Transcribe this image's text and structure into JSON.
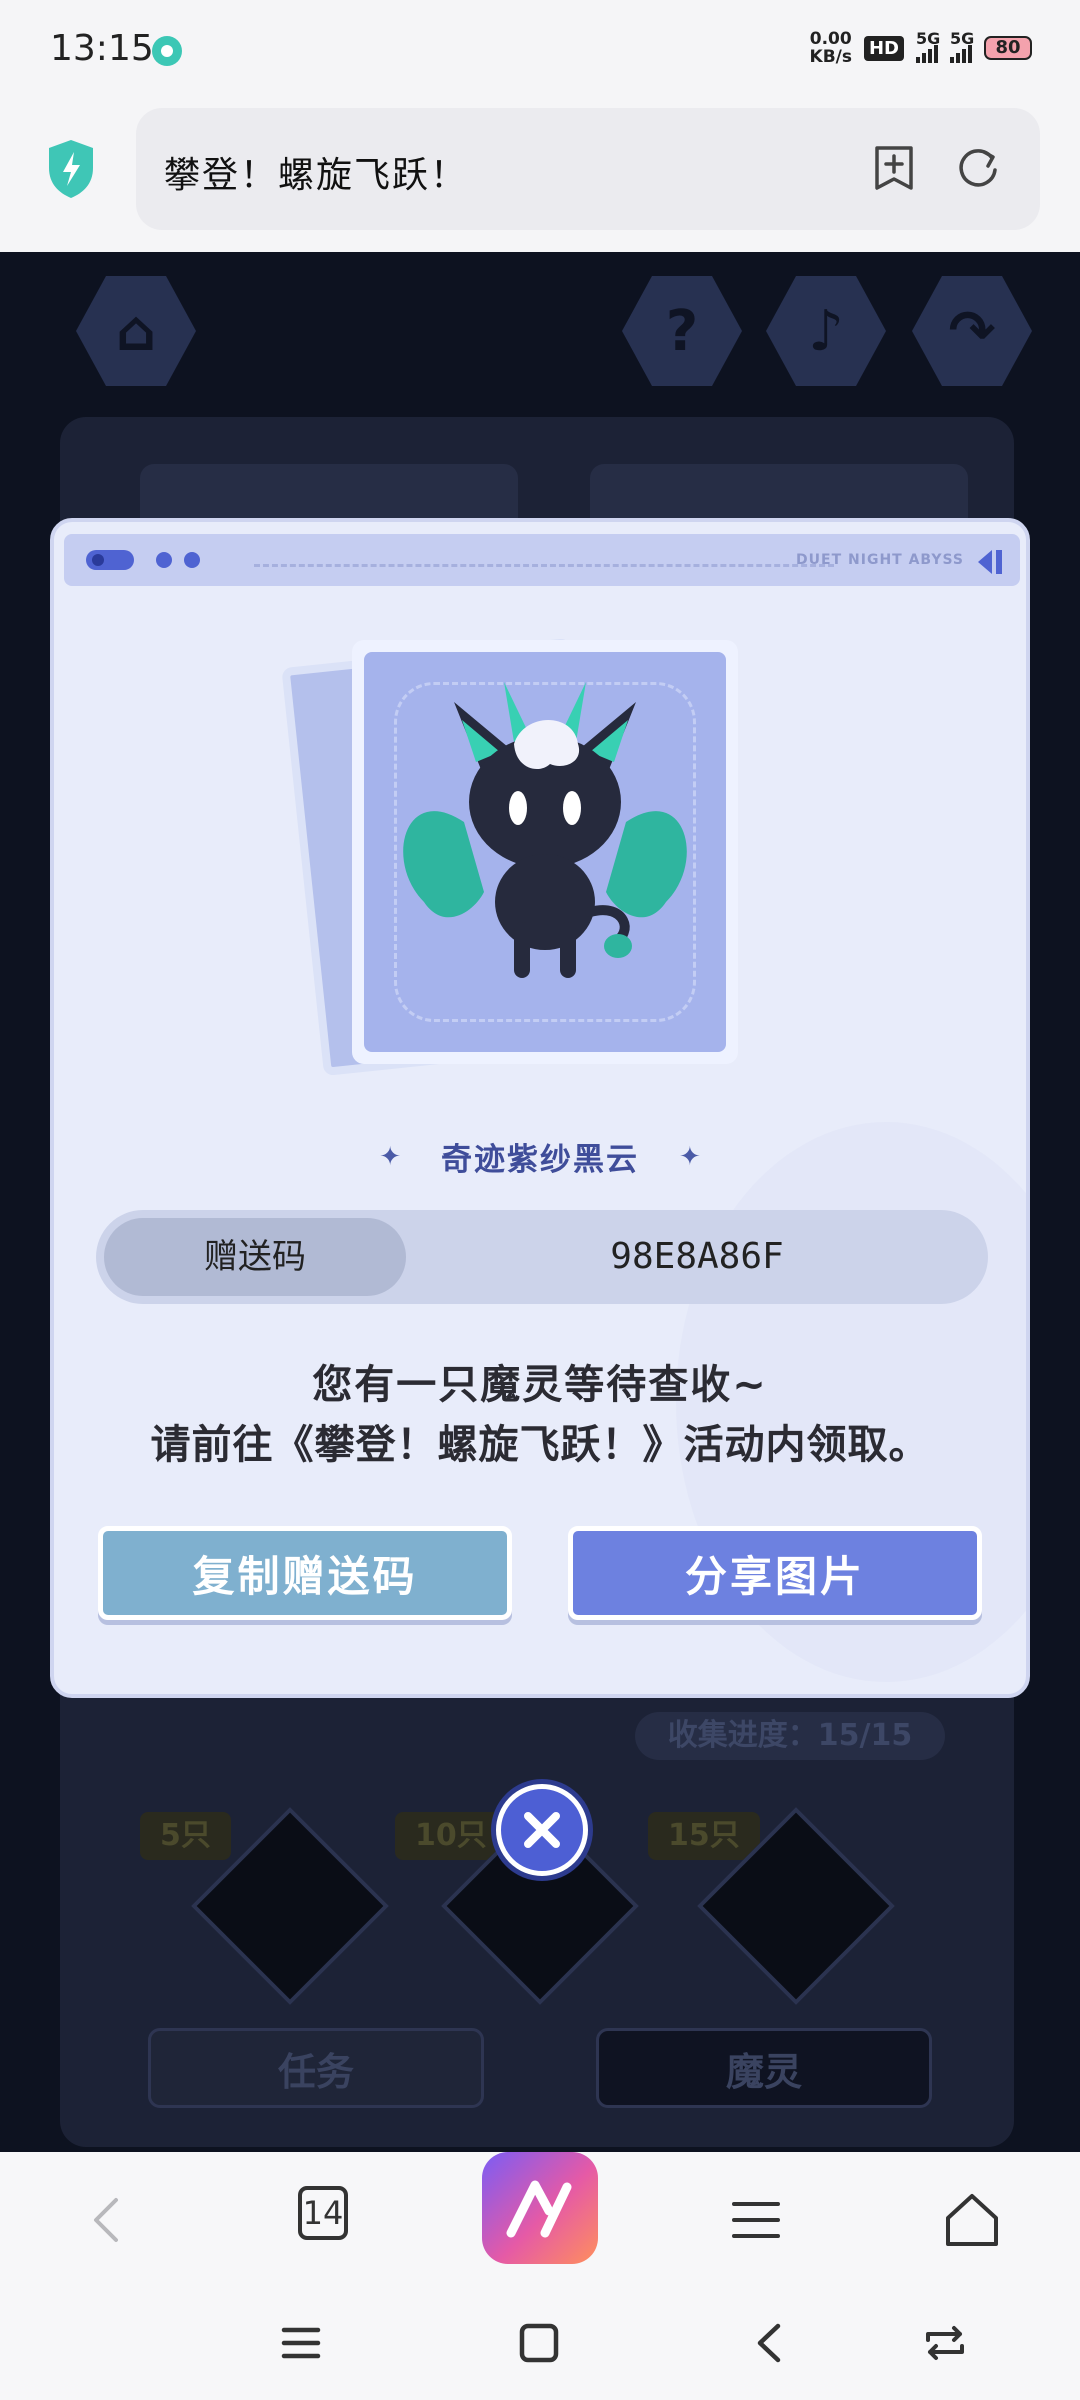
{
  "status_bar": {
    "time": "13:15",
    "net_speed_value": "0.00",
    "net_speed_unit": "KB/s",
    "hd_badge": "HD",
    "signal_1": "5G",
    "signal_2": "5G",
    "battery": "80"
  },
  "browser": {
    "page_title": "攀登！螺旋飞跃！",
    "tab_count": "14"
  },
  "background_page": {
    "progress_label": "收集进度：15/15",
    "milestones": [
      "5只",
      "10只",
      "15只"
    ],
    "task_button": "任务",
    "spirit_button": "魔灵"
  },
  "modal": {
    "header_brand": "DUET NIGHT ABYSS",
    "spirit_name": "奇迹紫纱黑云",
    "gift_code_label": "赠送码",
    "gift_code_value": "98E8A86F",
    "message_line1": "您有一只魔灵等待查收~",
    "message_line2": "请前往《攀登！螺旋飞跃！》活动内领取。",
    "copy_button": "复制赠送码",
    "share_button": "分享图片"
  },
  "colors": {
    "accent": "#6d81e0",
    "copy_button": "#7fb0cf",
    "modal_bg": "#e8ecfa",
    "page_bg": "#0d1220"
  }
}
